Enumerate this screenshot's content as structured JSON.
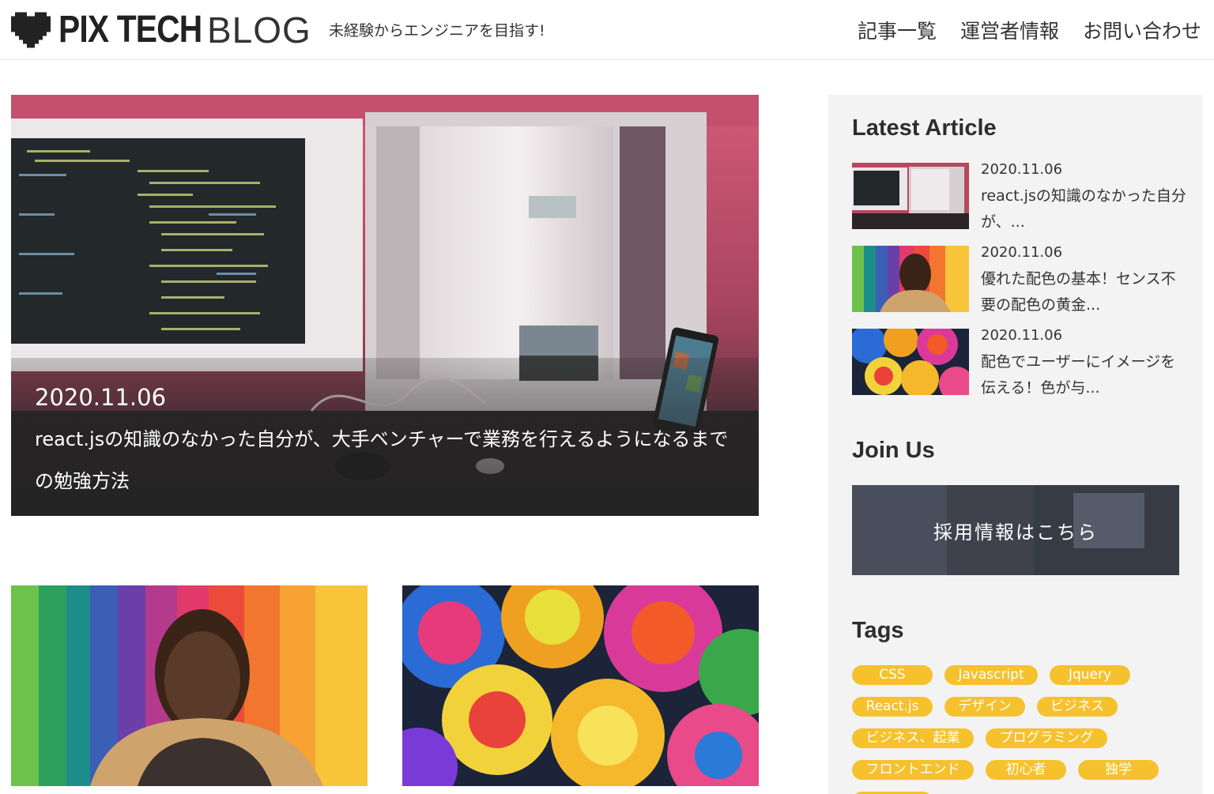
{
  "header": {
    "logo_text": "PIX TECH",
    "logo_suffix": "BLOG",
    "tagline": "未経験からエンジニアを目指す!",
    "nav": [
      "記事一覧",
      "運営者情報",
      "お問い合わせ"
    ]
  },
  "hero": {
    "date": "2020.11.06",
    "title": "react.jsの知識のなかった自分が、大手ベンチャーで業務を行えるようになるまでの勉強方法"
  },
  "cards": [
    {
      "image": "rainbow-wall-person"
    },
    {
      "image": "rainbow-roses"
    }
  ],
  "sidebar": {
    "latest_heading": "Latest Article",
    "latest": [
      {
        "date": "2020.11.06",
        "title": "react.jsの知識のなかった自分が、...",
        "image": "desk-monitors"
      },
      {
        "date": "2020.11.06",
        "title": "優れた配色の基本！センス不要の配色の黄金...",
        "image": "rainbow-wall-person"
      },
      {
        "date": "2020.11.06",
        "title": "配色でユーザーにイメージを伝える！色が与...",
        "image": "rainbow-roses"
      }
    ],
    "join_heading": "Join Us",
    "join_label": "採用情報はこちら",
    "tags_heading": "Tags",
    "tags": [
      "CSS",
      "Javascript",
      "Jquery",
      "React.js",
      "デザイン",
      "ビジネス",
      "ビジネス、起業",
      "プログラミング",
      "フロントエンド",
      "初心者",
      "独学"
    ]
  },
  "colors": {
    "tag_bg": "#f5c12d",
    "sidebar_bg": "#f3f3f3",
    "text": "#333333"
  }
}
